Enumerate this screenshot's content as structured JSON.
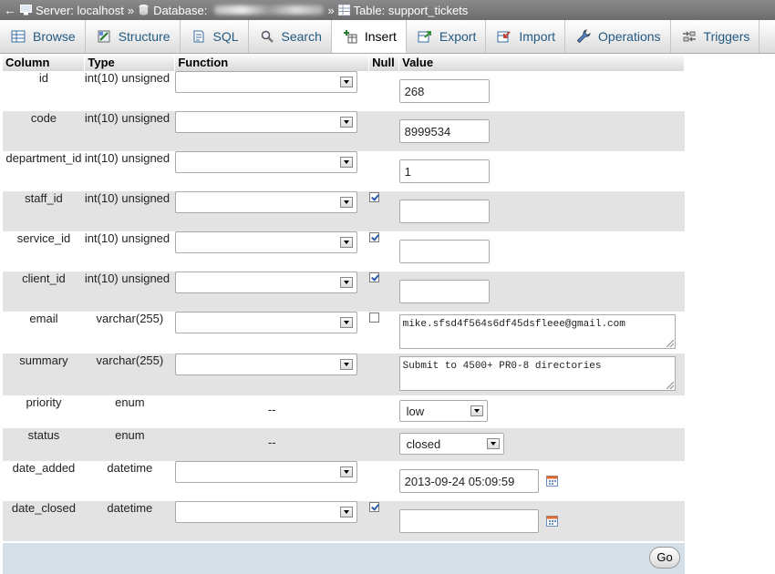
{
  "breadcrumb": {
    "server": "Server: localhost",
    "database": "Database:",
    "table": "Table: support_tickets",
    "sep": "»"
  },
  "tabs": [
    {
      "label": "Browse",
      "icon": "browse-icon"
    },
    {
      "label": "Structure",
      "icon": "structure-icon"
    },
    {
      "label": "SQL",
      "icon": "sql-icon"
    },
    {
      "label": "Search",
      "icon": "search-icon"
    },
    {
      "label": "Insert",
      "icon": "insert-icon",
      "active": true
    },
    {
      "label": "Export",
      "icon": "export-icon"
    },
    {
      "label": "Import",
      "icon": "import-icon"
    },
    {
      "label": "Operations",
      "icon": "operations-icon"
    },
    {
      "label": "Triggers",
      "icon": "triggers-icon"
    }
  ],
  "headers": {
    "column": "Column",
    "type": "Type",
    "function": "Function",
    "null": "Null",
    "value": "Value"
  },
  "rows": [
    {
      "column": "id",
      "type": "int(10) unsigned",
      "value": "268"
    },
    {
      "column": "code",
      "type": "int(10) unsigned",
      "value": "8999534"
    },
    {
      "column": "department_id",
      "type": "int(10) unsigned",
      "value": "1"
    },
    {
      "column": "staff_id",
      "type": "int(10) unsigned",
      "null_checked": true,
      "value": ""
    },
    {
      "column": "service_id",
      "type": "int(10) unsigned",
      "null_checked": true,
      "value": ""
    },
    {
      "column": "client_id",
      "type": "int(10) unsigned",
      "null_checked": true,
      "value": ""
    },
    {
      "column": "email",
      "type": "varchar(255)",
      "null_checked": false,
      "value": "mike.sfsd4f564s6df45dsfleee@gmail.com"
    },
    {
      "column": "summary",
      "type": "varchar(255)",
      "value": "Submit to 4500+ PR0-8 directories"
    },
    {
      "column": "priority",
      "type": "enum",
      "function": "--",
      "value": "low"
    },
    {
      "column": "status",
      "type": "enum",
      "function": "--",
      "value": "closed"
    },
    {
      "column": "date_added",
      "type": "datetime",
      "value": "2013-09-24 05:09:59"
    },
    {
      "column": "date_closed",
      "type": "datetime",
      "null_checked": true,
      "value": ""
    }
  ],
  "go_label": "Go",
  "colors": {
    "tab_link": "#235a81",
    "row_alt": "#e3e3e3",
    "footer": "#d5dfe8"
  }
}
